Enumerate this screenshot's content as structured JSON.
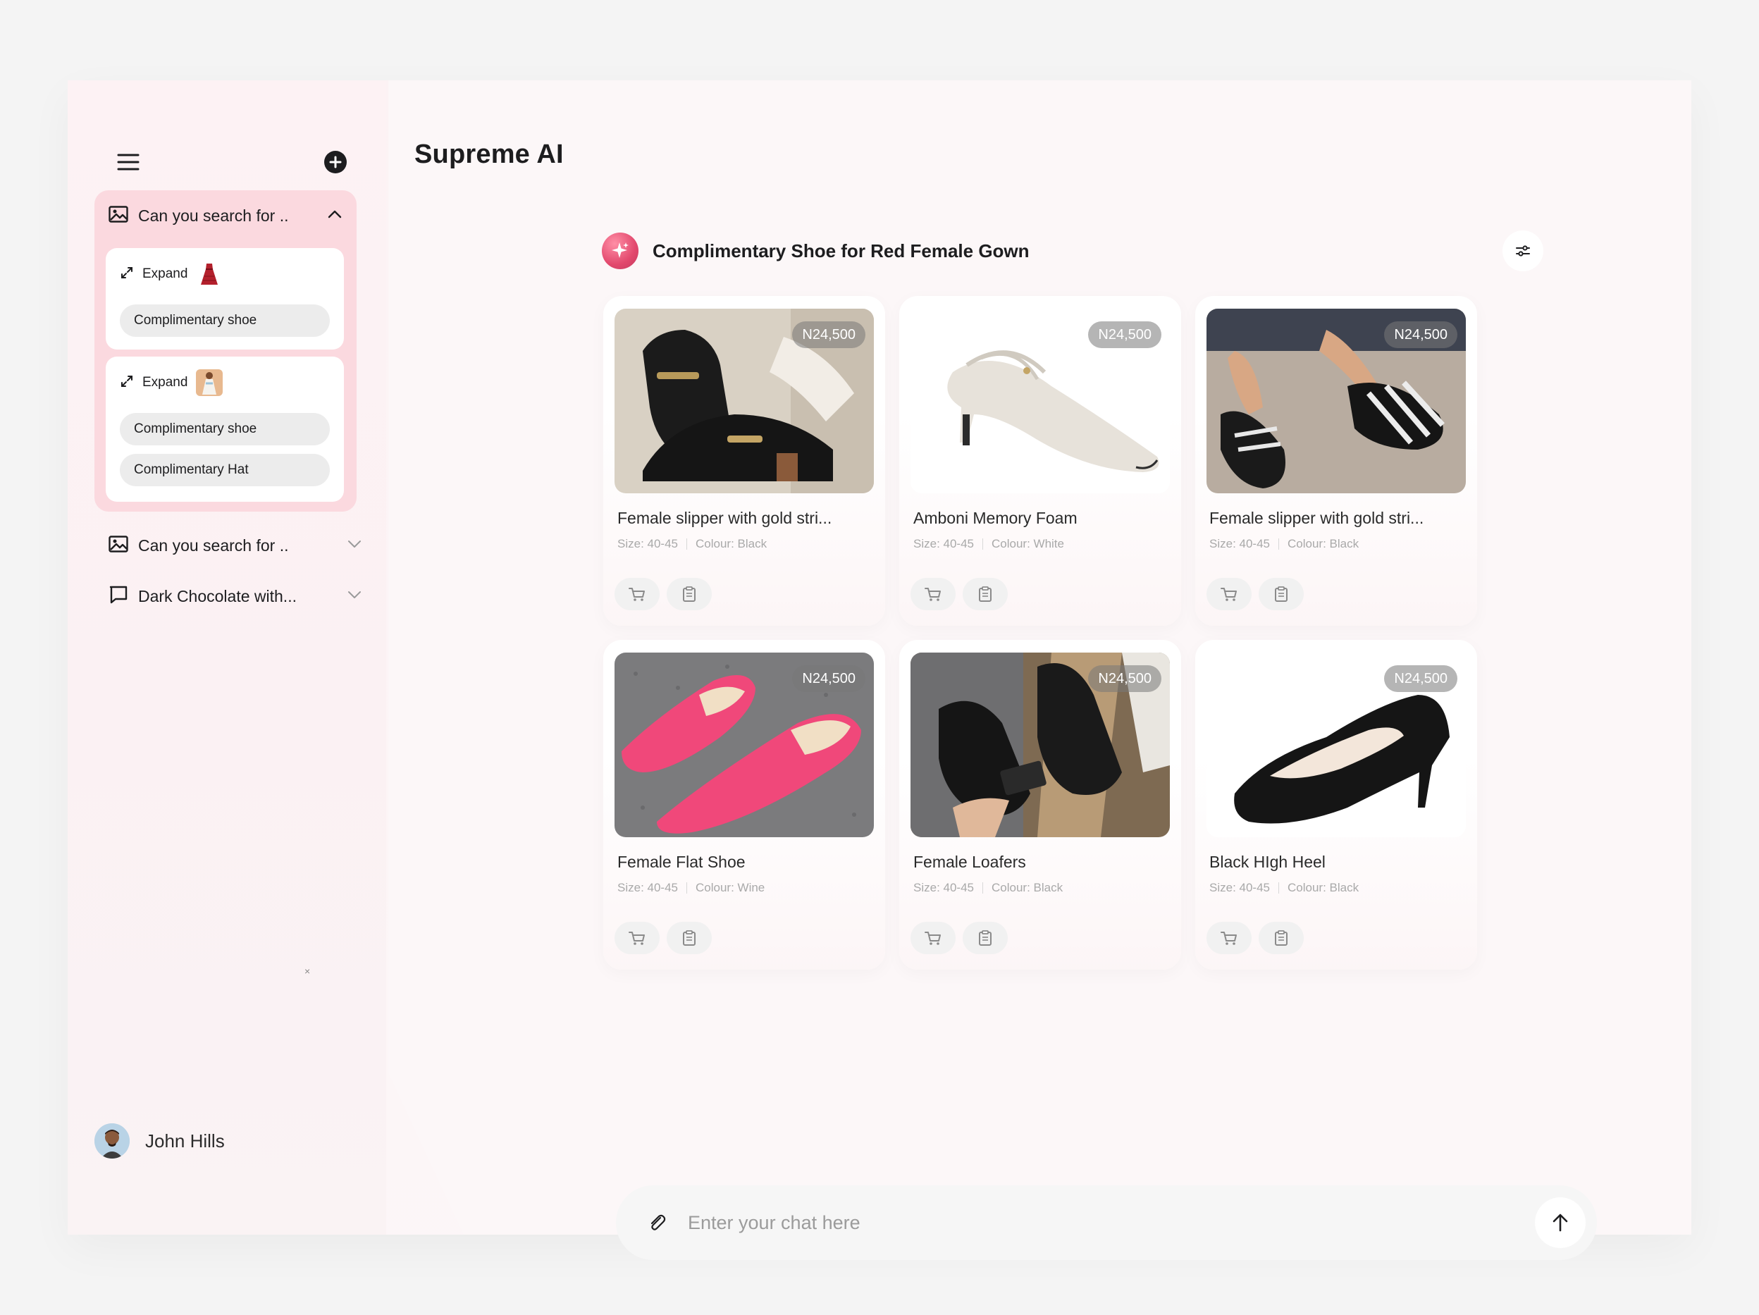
{
  "app": {
    "title": "Supreme AI"
  },
  "sidebar": {
    "threads": [
      {
        "label": "Can you search for ..",
        "icon": "image-icon",
        "expanded": true,
        "groups": [
          {
            "expand_label": "Expand",
            "chips": [
              "Complimentary shoe"
            ]
          },
          {
            "expand_label": "Expand",
            "chips": [
              "Complimentary shoe",
              "Complimentary Hat"
            ]
          }
        ]
      },
      {
        "label": "Can you search for ..",
        "icon": "image-icon",
        "expanded": false
      },
      {
        "label": "Dark Chocolate with...",
        "icon": "chat-bubble-icon",
        "expanded": false
      }
    ],
    "close_glyph": "×",
    "user": {
      "name": "John Hills"
    }
  },
  "results": {
    "title": "Complimentary Shoe for Red Female Gown",
    "products": [
      {
        "title": "Female slipper with gold stri...",
        "price": "N24,500",
        "size": "Size: 40-45",
        "colour": "Colour: Black"
      },
      {
        "title": "Amboni Memory Foam",
        "price": "N24,500",
        "size": "Size: 40-45",
        "colour": "Colour: White"
      },
      {
        "title": "Female slipper with gold stri...",
        "price": "N24,500",
        "size": "Size: 40-45",
        "colour": "Colour: Black"
      },
      {
        "title": "Female Flat Shoe",
        "price": "N24,500",
        "size": "Size: 40-45",
        "colour": "Colour: Wine"
      },
      {
        "title": "Female Loafers",
        "price": "N24,500",
        "size": "Size: 40-45",
        "colour": "Colour: Black"
      },
      {
        "title": "Black HIgh Heel",
        "price": "N24,500",
        "size": "Size: 40-45",
        "colour": "Colour: Black"
      }
    ]
  },
  "chat": {
    "placeholder": "Enter your chat here"
  },
  "colors": {
    "accent": "#e2486d",
    "sidebar_bg": "#fdf2f4",
    "thread_active_bg": "#fbd9df",
    "pill_bg": "#ececec"
  }
}
